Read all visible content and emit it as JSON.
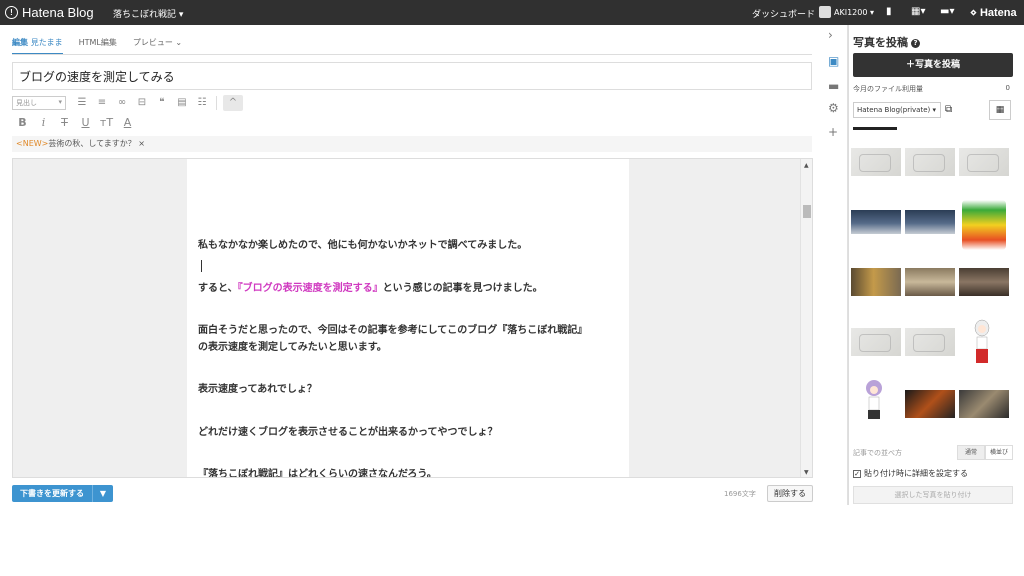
{
  "topbar": {
    "logo": "Hatena Blog",
    "blog_name": "落ちこぼれ戦記 ▾",
    "dashboard": "ダッシュボード",
    "user": "AKI1200 ▾",
    "hatena": "Hatena"
  },
  "tabs": [
    {
      "label": "編集",
      "sub": "見たまま"
    },
    {
      "label": "HTML編集"
    },
    {
      "label": "プレビュー ⌄"
    }
  ],
  "title": "ブログの速度を測定してみる",
  "toolbar": {
    "heading_select": "見出し",
    "collapse_icon": "^"
  },
  "notice": {
    "tag": "<NEW>",
    "text": "芸術の秋、してますか？",
    "close": "×"
  },
  "body": [
    {
      "text": "私もなかなか楽しめたので、他にも何かないかネットで調べてみました。"
    },
    {
      "pre": "すると、",
      "link": "『ブログの表示速度を測定する』",
      "post": "という感じの記事を見つけました。"
    },
    {
      "text": "面白そうだと思ったので、今回はその記事を参考にしてこのブログ『落ちこぼれ戦記』"
    },
    {
      "text": "の表示速度を測定してみたいと思います。"
    },
    {
      "text": "表示速度ってあれでしょ？"
    },
    {
      "text": "どれだけ速くブログを表示させることが出来るかってやつでしょ？"
    },
    {
      "text": "『落ちこぼれ戦記』はどれくらいの速さなんだろう。"
    }
  ],
  "footer": {
    "update_button": "下書きを更新する",
    "char_count": "1696文字",
    "delete_button": "削除する"
  },
  "panel": {
    "title": "写真を投稿",
    "post_button": "＋写真を投稿",
    "usage_label": "今月のファイル利用量",
    "usage_value": "0",
    "album_select": "Hatena Blog(private) ▾",
    "sort_label": "記事での並べ方",
    "sort_options": [
      "通常",
      "横並び"
    ],
    "detail_check": "貼り付け時に詳細を設定する",
    "paste_button": "選択した写真を貼り付け"
  },
  "colors": {
    "topbar": "#303030",
    "accent": "#3d8ac4",
    "link_pink": "#d03ac0",
    "update_button": "#3d94d0",
    "new_tag": "#e08a2b"
  }
}
